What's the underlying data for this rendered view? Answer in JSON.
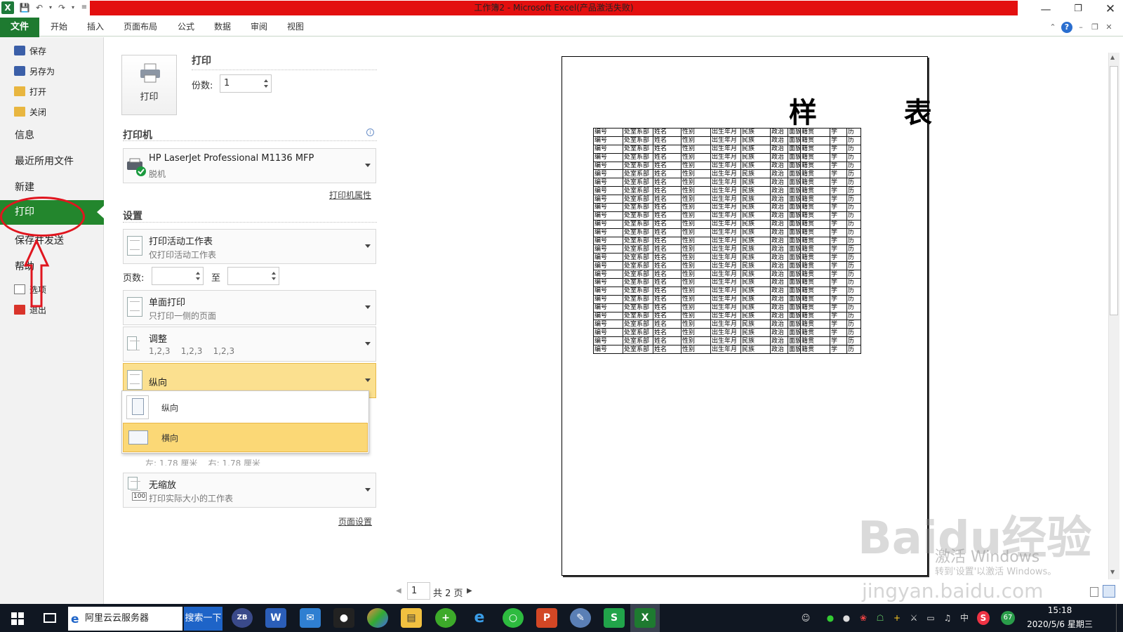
{
  "window": {
    "title": "工作簿2 - Microsoft Excel(产品激活失败)",
    "excel_badge": "X"
  },
  "ribbon": {
    "file_tab": "文件",
    "tabs": [
      "开始",
      "插入",
      "页面布局",
      "公式",
      "数据",
      "审阅",
      "视图"
    ]
  },
  "nav": {
    "save": "保存",
    "save_as": "另存为",
    "open": "打开",
    "close": "关闭",
    "info": "信息",
    "recent": "最近所用文件",
    "new": "新建",
    "print": "打印",
    "save_send": "保存并发送",
    "help": "帮助",
    "options": "选项",
    "exit": "退出"
  },
  "print": {
    "button_label": "打印",
    "heading": "打印",
    "copies_label": "份数:",
    "copies_value": "1"
  },
  "printer": {
    "heading": "打印机",
    "name": "HP LaserJet Professional M1136 MFP",
    "status": "脱机",
    "properties_link": "打印机属性"
  },
  "settings": {
    "heading": "设置",
    "what": {
      "title": "打印活动工作表",
      "sub": "仅打印活动工作表"
    },
    "pages_label": "页数:",
    "pages_to": "至",
    "sides": {
      "title": "单面打印",
      "sub": "只打印一侧的页面"
    },
    "collate": {
      "title": "调整",
      "sub": "1,2,3    1,2,3    1,2,3"
    },
    "orientation": {
      "title": "纵向"
    },
    "orientation_options": [
      "纵向",
      "横向"
    ],
    "margins_hidden": "左: 1.78 厘米    右: 1.78 厘米",
    "scaling": {
      "title": "无缩放",
      "sub": "打印实际大小的工作表",
      "badge": "100"
    },
    "page_setup_link": "页面设置"
  },
  "preview": {
    "title": "样 表",
    "columns": [
      "编号",
      "处室系部",
      "姓名",
      "性别",
      "出生年月",
      "民族",
      "政治",
      "面貌",
      "籍贯",
      "学",
      "历"
    ],
    "row_count": 27,
    "page_current": "1",
    "page_total": "共 2 页"
  },
  "watermark": {
    "line1": "Baidu经验",
    "line2": "jingyan.baidu.com",
    "activate1": "激活 Windows",
    "activate2": "转到'设置'以激活 Windows。"
  },
  "taskbar": {
    "search_text": "阿里云云服务器",
    "search_button": "搜索一下",
    "clock_time": "15:18",
    "clock_date": "2020/5/6 星期三",
    "ime": "中",
    "badge": "67"
  }
}
